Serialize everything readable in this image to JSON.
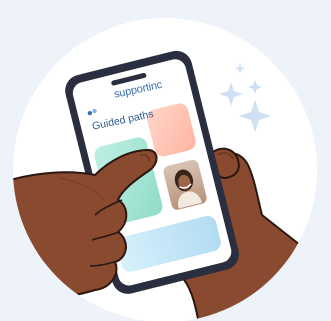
{
  "app": {
    "logo_text": "supportinc",
    "heading": "Guided paths"
  },
  "icons": {
    "logo_mark": "support-logo-icon",
    "sparkle": "sparkle-icon"
  },
  "colors": {
    "background": "#eef3f9",
    "circle": "#ffffff",
    "phone_frame": "#2b2e3f",
    "screen": "#ffffff",
    "skin": "#8a4a2f",
    "skin_shadow": "#6f3a24",
    "outline": "#2a1711",
    "sparkle": "#cfe0f3",
    "card_teal": "#a9ead8",
    "card_peach": "#ffc9b9",
    "card_blue": "#c5e6f7",
    "brand": "#3a6fa8"
  }
}
